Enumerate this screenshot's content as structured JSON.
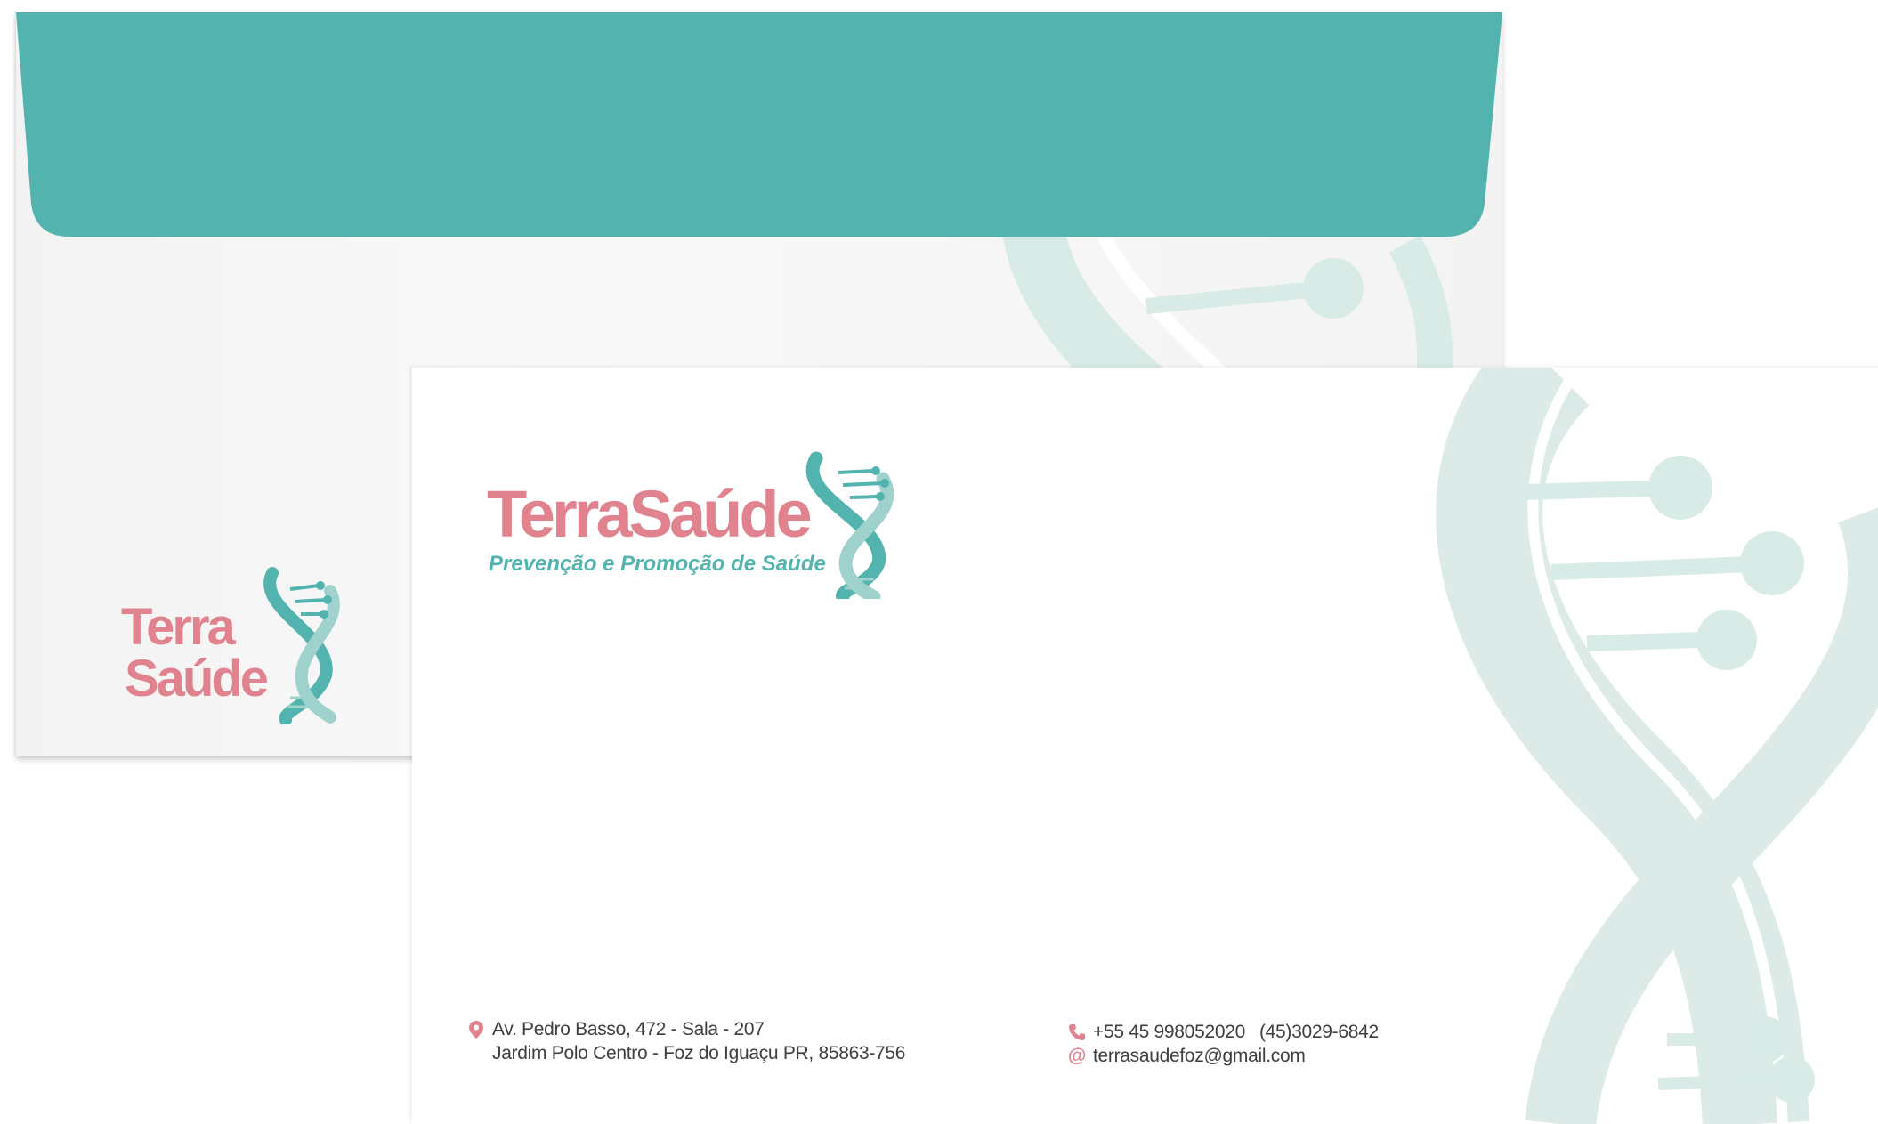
{
  "brand": {
    "name_part1": "Terra",
    "name_part2": "Saúde",
    "tagline": "Prevenção e Promoção de Saúde",
    "colors": {
      "teal": "#53b3ae",
      "pink": "#e0838f",
      "light_teal": "#d8ebe7"
    }
  },
  "contact": {
    "address_line1": "Av. Pedro Basso, 472 - Sala - 207",
    "address_line2": "Jardim Polo Centro - Foz do Iguaçu PR, 85863-756",
    "phone_mobile": "+55 45 998052020",
    "phone_landline": "(45)3029-6842",
    "email": "terrasaudefoz@gmail.com"
  },
  "icons": [
    "location-pin-icon",
    "phone-icon",
    "at-sign-icon",
    "dna-helix-icon"
  ]
}
